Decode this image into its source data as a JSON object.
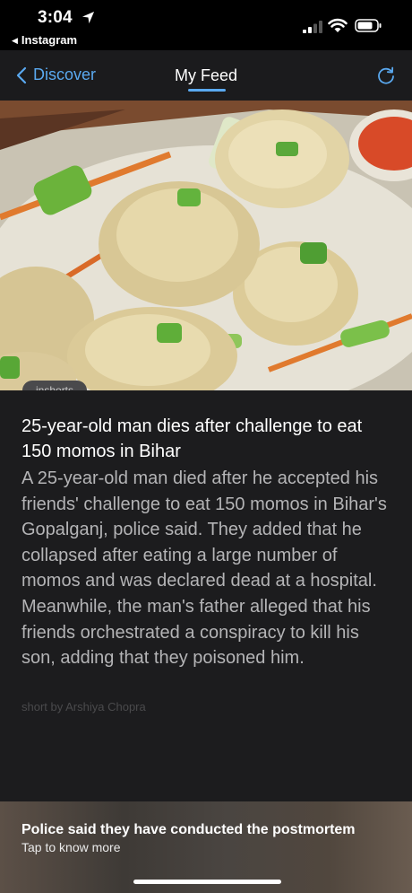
{
  "status_bar": {
    "time": "3:04",
    "back_app": "Instagram"
  },
  "nav": {
    "back_label": "Discover",
    "title": "My Feed",
    "accent_color": "#5aa9f0"
  },
  "article": {
    "source_badge": "inshorts",
    "headline": "25-year-old man dies after challenge to eat 150 momos in Bihar",
    "body": "A 25-year-old man died after he accepted his friends' challenge to eat 150 momos in Bihar's Gopalganj, police said. They added that he collapsed after eating a large number of momos and was declared dead at a hospital. Meanwhile, the man's father alleged that his friends orchestrated a conspiracy to kill his son, adding that they poisoned him.",
    "byline": "short by Arshiya Chopra"
  },
  "footer": {
    "title": "Police said they have conducted the postmortem",
    "subtitle": "Tap to know more"
  }
}
